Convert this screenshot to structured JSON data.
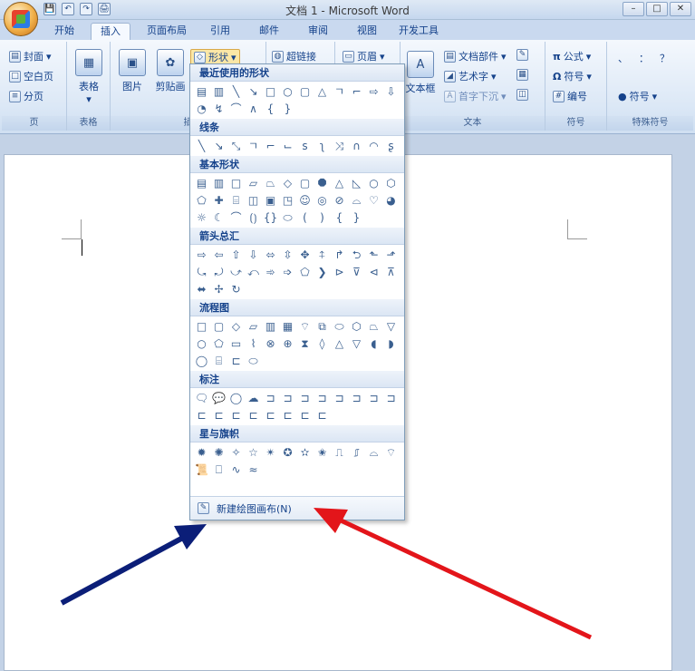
{
  "window": {
    "title": "文档 1 - Microsoft Word",
    "buttons": [
      "–",
      "□",
      "✕"
    ]
  },
  "qat": [
    "💾",
    "↶",
    "↷",
    "🖨"
  ],
  "tabs": [
    "开始",
    "插入",
    "页面布局",
    "引用",
    "邮件",
    "审阅",
    "视图",
    "开发工具"
  ],
  "ribbon": {
    "pages_group": {
      "label": "页",
      "items": [
        "封面",
        "空白页",
        "分页"
      ]
    },
    "table_group": {
      "label": "表格",
      "button": "表格"
    },
    "illus_group": {
      "label": "插",
      "buttons": [
        "图片",
        "剪贴画"
      ],
      "shapes": "形状"
    },
    "link_group": {
      "hyperlink": "超链接"
    },
    "header_group": {
      "header": "页眉"
    },
    "text_group": {
      "label": "文本",
      "textbox": "文本框",
      "items": [
        "文档部件",
        "艺术字",
        "首字下沉"
      ]
    },
    "symbol_group": {
      "label": "符号",
      "items": [
        "公式",
        "符号",
        "编号"
      ]
    },
    "special_group": {
      "label": "特殊符号",
      "items": [
        "、",
        "：",
        "？",
        "符号"
      ]
    }
  },
  "dropdown": {
    "sections": [
      {
        "title": "最近使用的形状"
      },
      {
        "title": "线条"
      },
      {
        "title": "基本形状"
      },
      {
        "title": "箭头总汇"
      },
      {
        "title": "流程图"
      },
      {
        "title": "标注"
      },
      {
        "title": "星与旗帜"
      }
    ],
    "footer": "新建绘图画布(N)"
  },
  "colors": {
    "blue_arrow": "#0b1e78",
    "red_arrow": "#e3151a"
  }
}
